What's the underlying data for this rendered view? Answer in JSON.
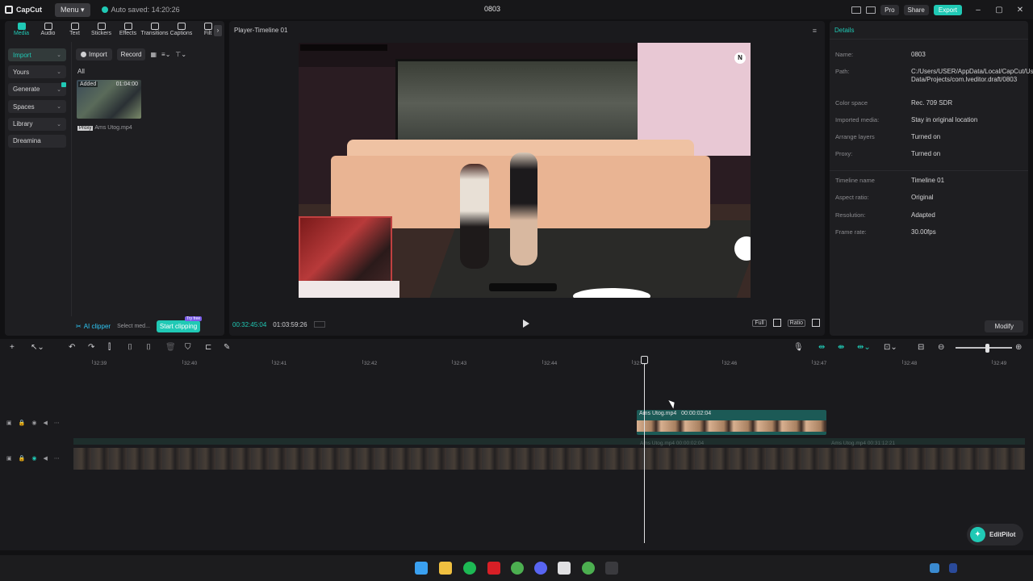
{
  "titlebar": {
    "app_name": "CapCut",
    "menu_label": "Menu",
    "autosave": "Auto saved: 14:20:26",
    "project_title": "0803",
    "pro_label": "Pro",
    "share_label": "Share",
    "export_label": "Export"
  },
  "tabs": [
    "Media",
    "Audio",
    "Text",
    "Stickers",
    "Effects",
    "Transitions",
    "Captions",
    "Filt"
  ],
  "sidebar": {
    "items": [
      {
        "label": "Import"
      },
      {
        "label": "Yours"
      },
      {
        "label": "Generate"
      },
      {
        "label": "Spaces"
      },
      {
        "label": "Library"
      },
      {
        "label": "Dreamina"
      }
    ]
  },
  "media": {
    "import_label": "Import",
    "record_label": "Record",
    "all_label": "All",
    "thumb_added": "Added",
    "thumb_duration": "01:04:00",
    "proxy_tag": "Proxy",
    "file_name": "Ams Utog.mp4"
  },
  "clipper": {
    "label": "AI clipper",
    "select": "Select med...",
    "button": "Start clipping",
    "tryfree": "Try free"
  },
  "player": {
    "title": "Player-Timeline 01",
    "current_time": "00:32:45:04",
    "total_time": "01:03:59:26",
    "full_label": "Full",
    "ratio_label": "Ratio"
  },
  "details": {
    "title": "Details",
    "rows": [
      {
        "key": "Name:",
        "value": "0803"
      },
      {
        "key": "Path:",
        "value": "C:/Users/USER/AppData/Local/CapCut/User Data/Projects/com.lveditor.draft/0803"
      },
      {
        "key": "Color space",
        "value": "Rec. 709 SDR"
      },
      {
        "key": "Imported media:",
        "value": "Stay in original location"
      },
      {
        "key": "Arrange layers",
        "value": "Turned on"
      },
      {
        "key": "Proxy:",
        "value": "Turned on"
      },
      {
        "key": "Timeline name",
        "value": "Timeline 01"
      },
      {
        "key": "Aspect ratio:",
        "value": "Original"
      },
      {
        "key": "Resolution:",
        "value": "Adapted"
      },
      {
        "key": "Frame rate:",
        "value": "30.00fps"
      }
    ],
    "modify_label": "Modify"
  },
  "timeline": {
    "ruler": [
      "32:39",
      "32:40",
      "32:41",
      "32:42",
      "32:43",
      "32:44",
      "32:45",
      "32:46",
      "32:47",
      "32:48",
      "32:49"
    ],
    "overlay_clip": {
      "name": "Ams Utog.mp4",
      "duration": "00:00:02:04"
    },
    "main_clip": {
      "name": "Ams Utog.mp4",
      "duration": "00:00:02:04",
      "name2": "Ams Utog.mp4",
      "duration2": "00:31:12:21"
    }
  },
  "editpilot_label": "EditPilot",
  "colors": {
    "accent": "#20c9b5",
    "background": "#111113"
  }
}
